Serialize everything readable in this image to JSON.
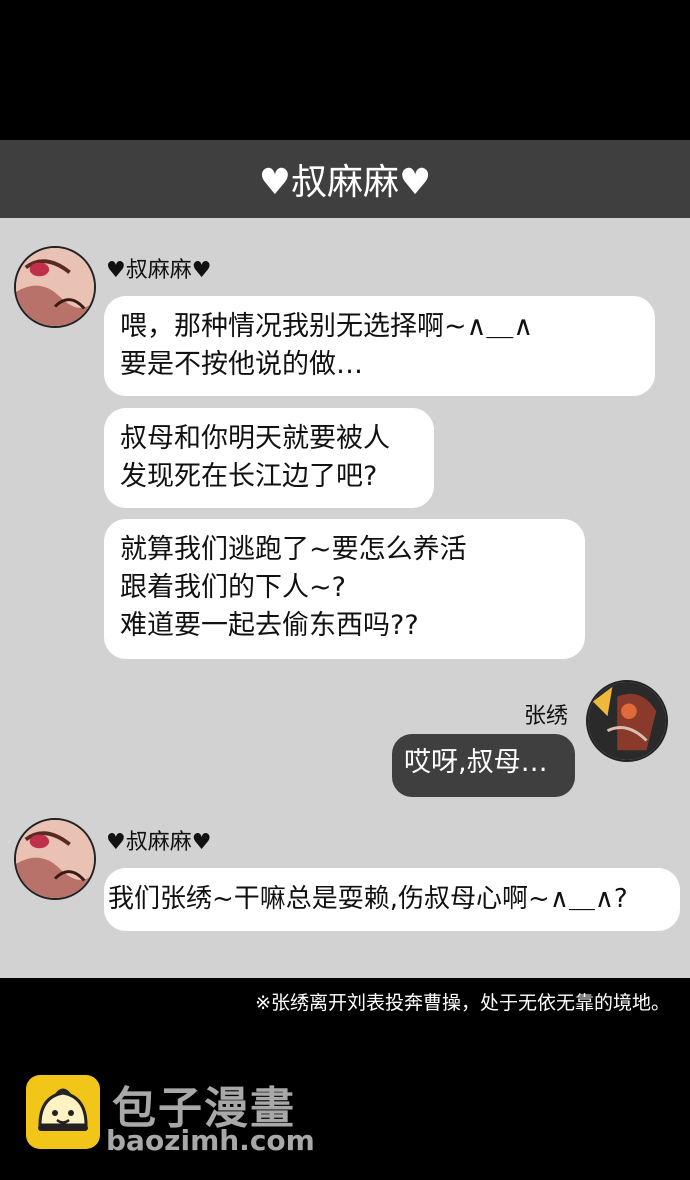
{
  "header": {
    "title": "♥叔麻麻♥"
  },
  "messages": [
    {
      "sender": "♥叔麻麻♥",
      "avatar_icon": "aunt-avatar",
      "bubbles": [
        "喂，那种情况我别无选择啊~∧＿∧\n要是不按他说的做…",
        "叔母和你明天就要被人\n发现死在长江边了吧?",
        "就算我们逃跑了~要怎么养活\n跟着我们的下人~?\n难道要一起去偷东西吗??"
      ]
    },
    {
      "sender": "张绣",
      "avatar_icon": "zhangxiu-avatar",
      "bubbles": [
        "哎呀,叔母…"
      ]
    },
    {
      "sender": "♥叔麻麻♥",
      "avatar_icon": "aunt-avatar",
      "bubbles": [
        "我们张绣~干嘛总是耍赖,伤叔母心啊~∧＿∧?"
      ]
    }
  ],
  "footnote": "※张绣离开刘表投奔曹操，处于无依无靠的境地。",
  "watermark": {
    "name": "包子漫畫",
    "url": "baozimh.com",
    "logo_icon": "bun-logo-icon"
  },
  "colors": {
    "header_bg": "#3f3f3f",
    "chat_bg": "#d2d2d2",
    "bubble_self_bg": "#3f3f3f",
    "logo_bg": "#f2c618"
  }
}
